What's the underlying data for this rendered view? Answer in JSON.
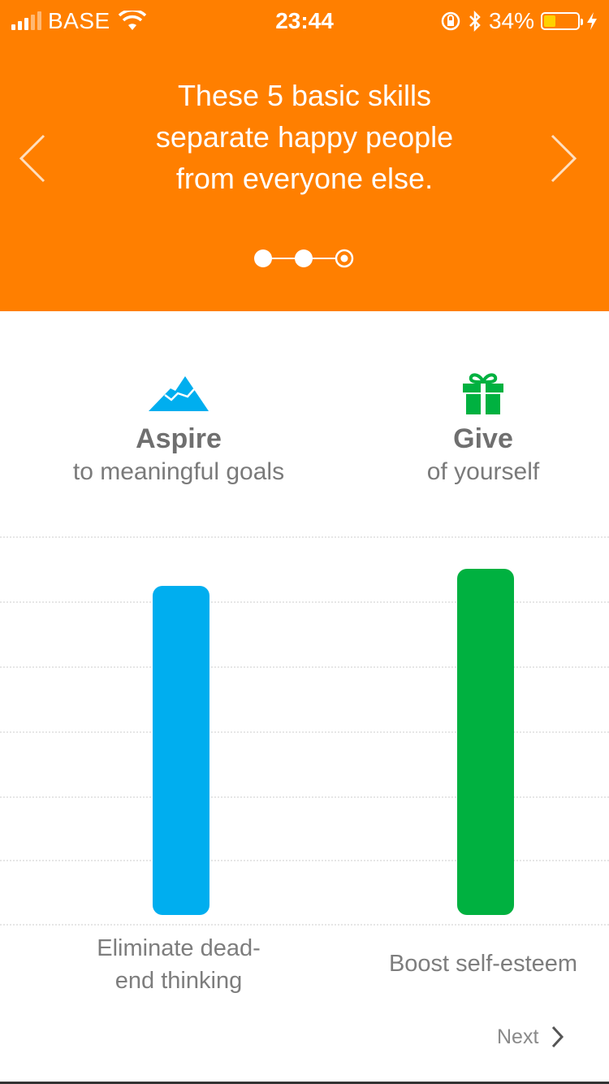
{
  "status_bar": {
    "carrier": "BASE",
    "time": "23:44",
    "battery_percent": "34%",
    "battery_level": 0.34,
    "battery_color": "#FFD200",
    "icons": [
      "signal-icon",
      "wifi-icon",
      "rotation-lock-icon",
      "bluetooth-icon",
      "battery-icon",
      "charging-icon"
    ]
  },
  "hero": {
    "background": "#FF7F00",
    "title_lines": [
      "These 5 basic skills",
      "separate happy people",
      "from everyone else."
    ],
    "pager": {
      "total": 3,
      "current": 3
    }
  },
  "skills": [
    {
      "name": "Aspire",
      "subtitle": "to meaningful goals",
      "icon": "mountain-icon",
      "color": "#00AEEF",
      "bar_value": 0.95,
      "bar_label": [
        "Eliminate dead-",
        "end thinking"
      ]
    },
    {
      "name": "Give",
      "subtitle": "of yourself",
      "icon": "gift-icon",
      "color": "#00B140",
      "bar_value": 1.0,
      "bar_label": [
        "Boost self-esteem"
      ]
    }
  ],
  "footer": {
    "next_label": "Next"
  }
}
